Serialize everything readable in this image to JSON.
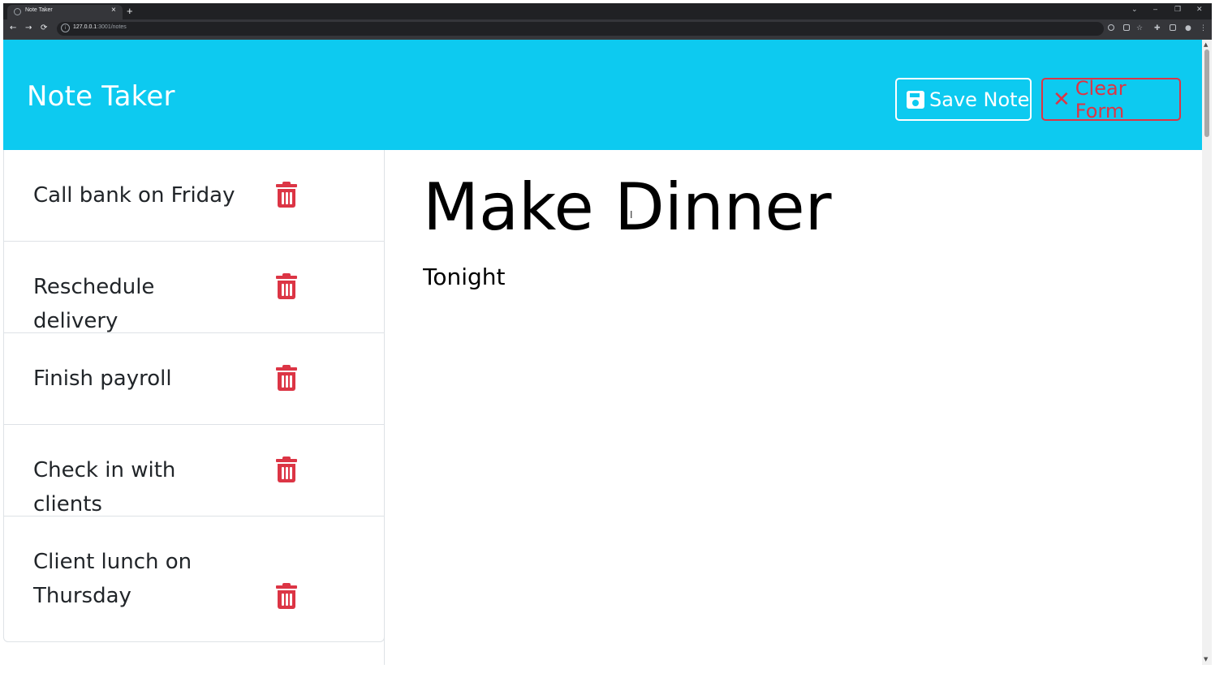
{
  "browser": {
    "tab_title": "Note Taker",
    "tab_close": "×",
    "new_tab": "+",
    "url_host": "127.0.0.1",
    "url_path": ":3001/notes",
    "window_controls": [
      "⌄",
      "–",
      "❐",
      "✕"
    ],
    "nav": {
      "back": "←",
      "forward": "→",
      "reload": "⟳"
    }
  },
  "header": {
    "brand": "Note Taker",
    "save_label": "Save Note",
    "clear_label": "Clear Form"
  },
  "notes": [
    {
      "title": "Call bank on Friday"
    },
    {
      "title": "Reschedule delivery"
    },
    {
      "title": "Finish payroll"
    },
    {
      "title": "Check in with clients"
    },
    {
      "title": "Client lunch on Thursday"
    }
  ],
  "editor": {
    "title_value": "Make Dinner",
    "body_value": "Tonight"
  },
  "icons": {
    "save": "floppy-disk-icon",
    "clear": "x-icon",
    "delete": "trash-icon"
  },
  "colors": {
    "header_bg": "#0dcaf0",
    "danger": "#dc3545",
    "text": "#212529",
    "chrome_dark": "#202124",
    "chrome_toolbar": "#35363a"
  }
}
